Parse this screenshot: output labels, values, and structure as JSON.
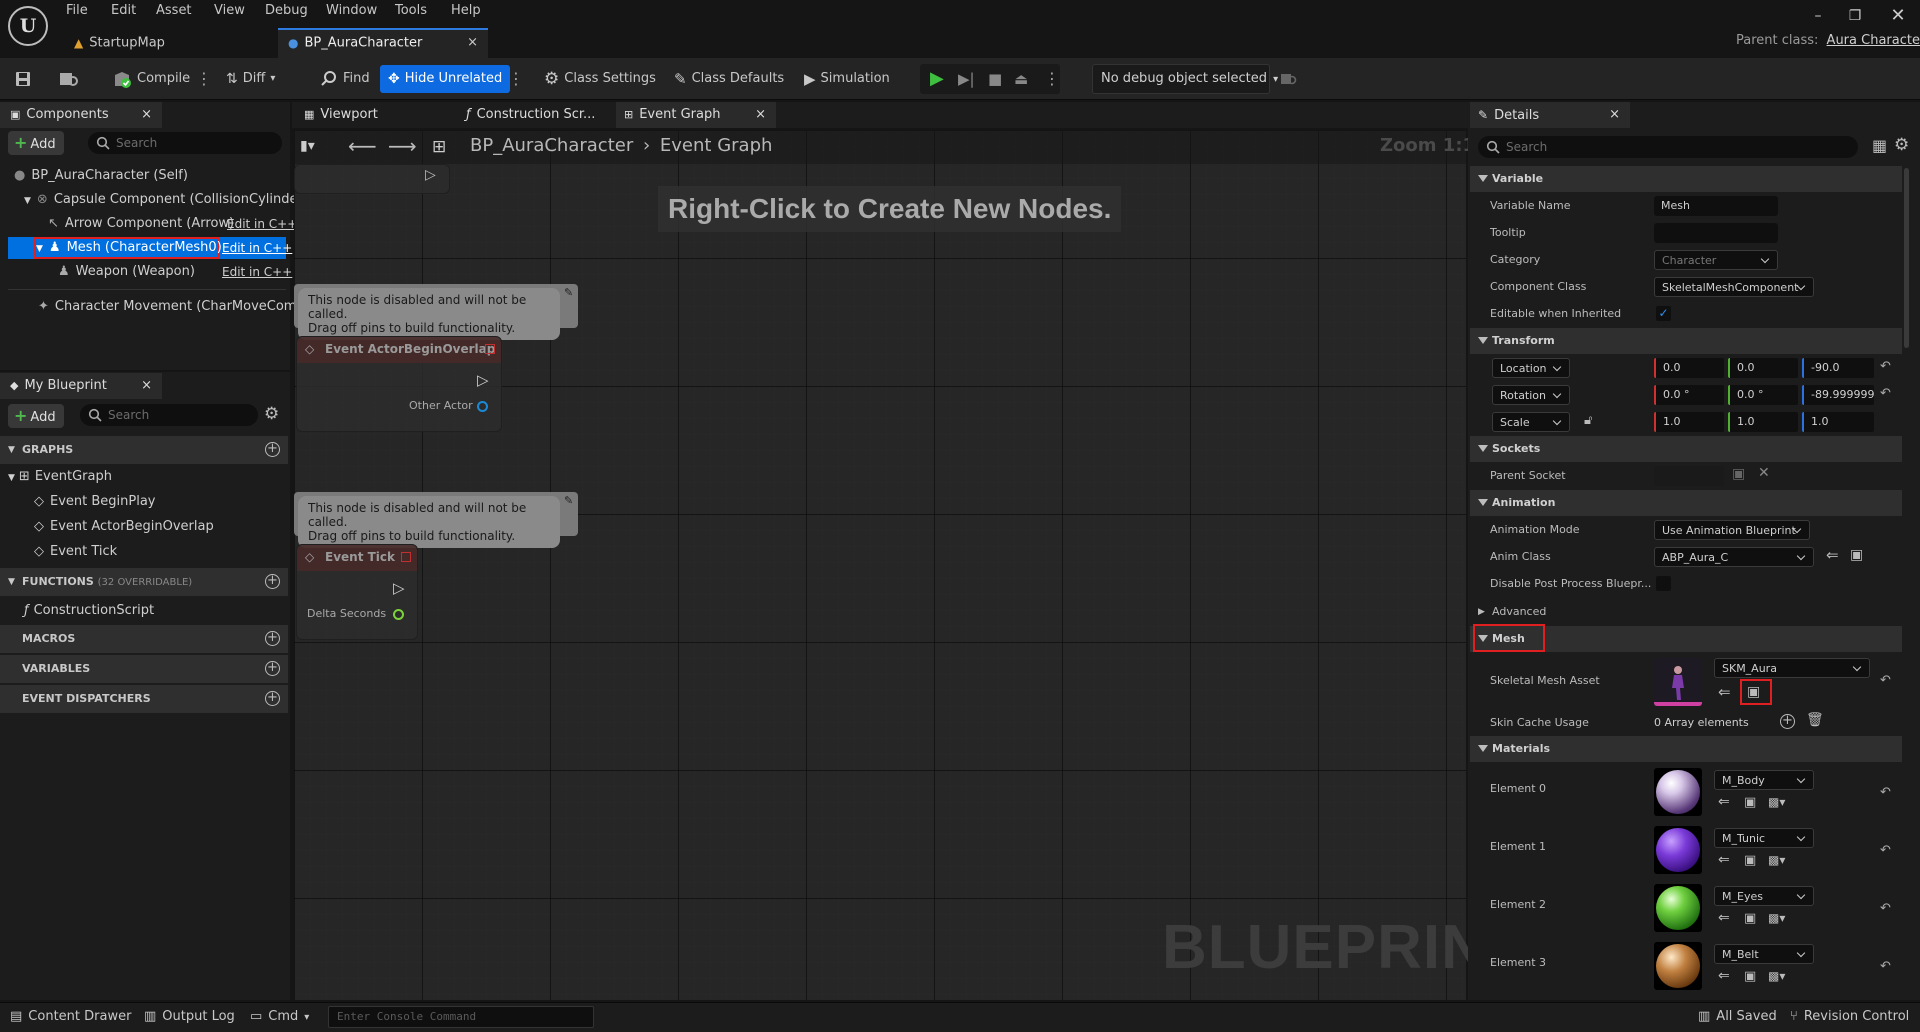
{
  "menu": [
    "File",
    "Edit",
    "Asset",
    "View",
    "Debug",
    "Window",
    "Tools",
    "Help"
  ],
  "doc_tabs": [
    {
      "label": "StartupMap",
      "active": false
    },
    {
      "label": "BP_AuraCharacter",
      "active": true
    }
  ],
  "parent_class": {
    "label": "Parent class:",
    "value": "Aura Character"
  },
  "toolbar": {
    "compile": "Compile",
    "diff": "Diff",
    "find": "Find",
    "hide_unrelated": "Hide Unrelated",
    "class_settings": "Class Settings",
    "class_defaults": "Class Defaults",
    "simulation": "Simulation",
    "debug_object": "No debug object selected"
  },
  "components": {
    "tab": "Components",
    "add": "Add",
    "search_placeholder": "Search",
    "items": [
      {
        "label": "BP_AuraCharacter (Self)"
      },
      {
        "label": "Capsule Component (CollisionCylinder)"
      },
      {
        "label": "Arrow Component (Arrow)",
        "edit": "Edit in C++"
      },
      {
        "label": "Mesh (CharacterMesh0)",
        "edit": "Edit in C++",
        "selected": true
      },
      {
        "label": "Weapon (Weapon)",
        "edit": "Edit in C++"
      },
      {
        "label": "Character Movement (CharMoveComp)"
      }
    ]
  },
  "my_blueprint": {
    "tab": "My Blueprint",
    "add": "Add",
    "search_placeholder": "Search",
    "graphs": "GRAPHS",
    "event_graph": "EventGraph",
    "events": [
      "Event BeginPlay",
      "Event ActorBeginOverlap",
      "Event Tick"
    ],
    "functions": "FUNCTIONS",
    "functions_count": "(32 OVERRIDABLE)",
    "construction_script": "ConstructionScript",
    "macros": "MACROS",
    "variables": "VARIABLES",
    "event_dispatchers": "EVENT DISPATCHERS"
  },
  "graph": {
    "tabs": [
      {
        "label": "Viewport"
      },
      {
        "label": "Construction Scr..."
      },
      {
        "label": "Event Graph",
        "active": true
      }
    ],
    "breadcrumb_root": "BP_AuraCharacter",
    "breadcrumb_leaf": "Event Graph",
    "zoom": "Zoom 1:1",
    "hint": "Right-Click to Create New Nodes.",
    "disabled_note_1": "This node is disabled and will not be called.",
    "disabled_note_2": "Drag off pins to build functionality.",
    "node_overlap": "Event ActorBeginOverlap",
    "pin_other_actor": "Other Actor",
    "node_tick": "Event Tick",
    "pin_delta": "Delta Seconds",
    "watermark": "BLUEPRINT"
  },
  "details": {
    "tab": "Details",
    "search_placeholder": "Search",
    "sections": {
      "variable": "Variable",
      "transform": "Transform",
      "sockets": "Sockets",
      "animation": "Animation",
      "advanced": "Advanced",
      "mesh": "Mesh",
      "materials": "Materials"
    },
    "variable_name": {
      "label": "Variable Name",
      "value": "Mesh"
    },
    "tooltip": {
      "label": "Tooltip",
      "value": ""
    },
    "category": {
      "label": "Category",
      "value": "Character"
    },
    "component_class": {
      "label": "Component Class",
      "value": "SkeletalMeshComponent"
    },
    "editable_inherited": {
      "label": "Editable when Inherited",
      "checked": true
    },
    "location": {
      "label": "Location",
      "x": "0.0",
      "y": "0.0",
      "z": "-90.0"
    },
    "rotation": {
      "label": "Rotation",
      "x": "0.0 °",
      "y": "0.0 °",
      "z": "-89.999999"
    },
    "scale": {
      "label": "Scale",
      "x": "1.0",
      "y": "1.0",
      "z": "1.0"
    },
    "parent_socket": {
      "label": "Parent Socket"
    },
    "animation_mode": {
      "label": "Animation Mode",
      "value": "Use Animation Blueprint"
    },
    "anim_class": {
      "label": "Anim Class",
      "value": "ABP_Aura_C"
    },
    "disable_post": {
      "label": "Disable Post Process Bluepr..."
    },
    "skeletal_mesh": {
      "label": "Skeletal Mesh Asset",
      "value": "SKM_Aura"
    },
    "skin_cache": {
      "label": "Skin Cache Usage",
      "value": "0 Array elements"
    },
    "materials": [
      {
        "label": "Element 0",
        "value": "M_Body"
      },
      {
        "label": "Element 1",
        "value": "M_Tunic"
      },
      {
        "label": "Element 2",
        "value": "M_Eyes"
      },
      {
        "label": "Element 3",
        "value": "M_Belt"
      }
    ]
  },
  "statusbar": {
    "content_drawer": "Content Drawer",
    "output_log": "Output Log",
    "cmd": "Cmd",
    "console_placeholder": "Enter Console Command",
    "all_saved": "All Saved",
    "revision_control": "Revision Control"
  },
  "colors": {
    "accent": "#0e6ae0",
    "selected": "#0070e0",
    "highlight_box": "#e02020",
    "play": "#3fbf3f"
  }
}
